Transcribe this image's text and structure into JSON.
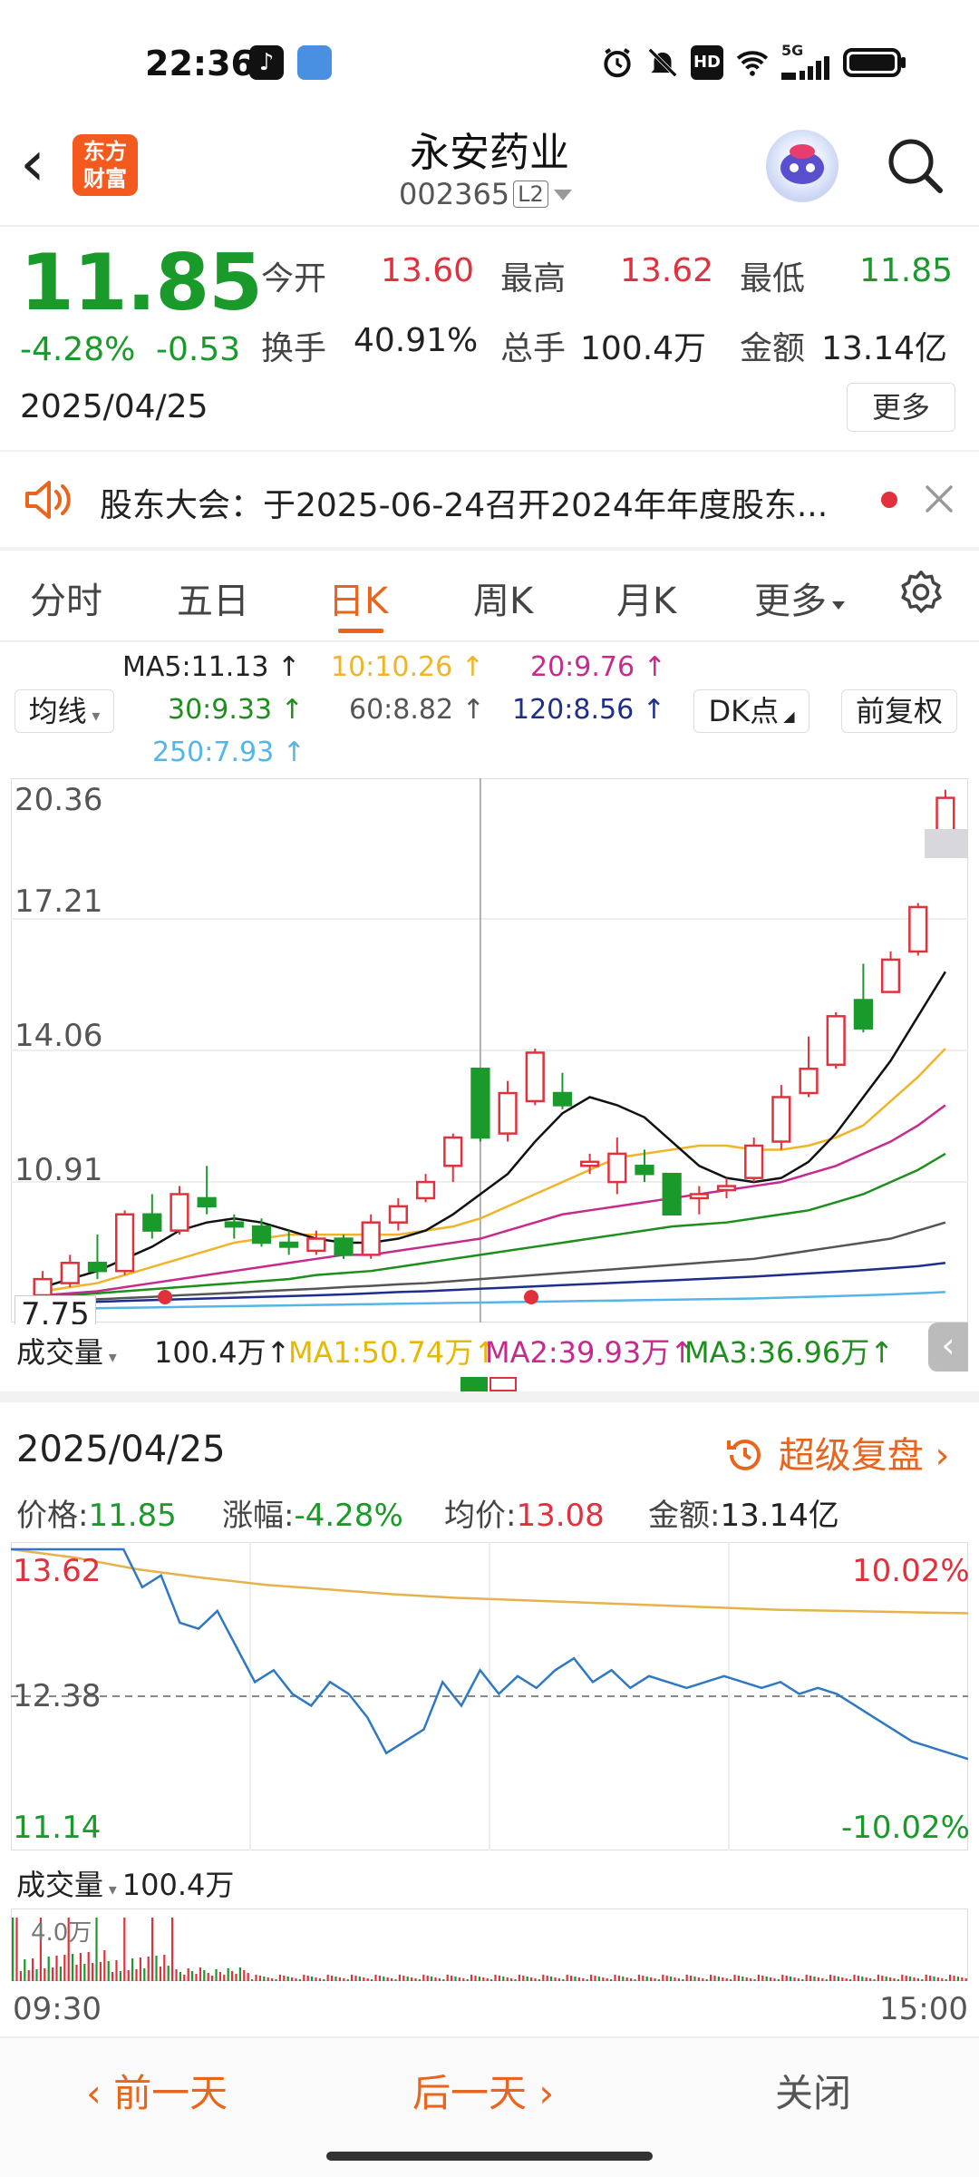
{
  "status": {
    "time": "22:36",
    "network": "5G"
  },
  "header": {
    "title": "永安药业",
    "code": "002365",
    "level": "L2",
    "logo": "东方财富"
  },
  "quote": {
    "price": "11.85",
    "change_pct": "-4.28%",
    "change": "-0.53",
    "date": "2025/04/25",
    "open_label": "今开",
    "open": "13.60",
    "high_label": "最高",
    "high": "13.62",
    "low_label": "最低",
    "low": "11.85",
    "turnover_label": "换手",
    "turnover": "40.91%",
    "volume_label": "总手",
    "volume": "100.4万",
    "amount_label": "金额",
    "amount": "13.14亿",
    "more_label": "更多"
  },
  "notice": {
    "text": "股东大会：于2025-06-24召开2024年年度股东..."
  },
  "tabs": [
    "分时",
    "五日",
    "日K",
    "周K",
    "月K",
    "更多"
  ],
  "active_tab": 2,
  "ma": {
    "button": "均线",
    "items": [
      {
        "label": "MA5:11.13",
        "color": "#222222"
      },
      {
        "label": "10:10.26",
        "color": "#f0b429"
      },
      {
        "label": "20:9.76",
        "color": "#c72a8d"
      },
      {
        "label": "30:9.33",
        "color": "#1c8f1c"
      },
      {
        "label": "60:8.82",
        "color": "#555555"
      },
      {
        "label": "120:8.56",
        "color": "#1f2d8c"
      },
      {
        "label": "250:7.93",
        "color": "#55b6e6"
      }
    ],
    "dk": "DK点",
    "fq": "前复权"
  },
  "kaxis": [
    "20.36",
    "17.21",
    "14.06",
    "10.91",
    "7.75"
  ],
  "volbar": {
    "label": "成交量",
    "value": "100.4万",
    "ma1": "MA1:50.74万",
    "ma2": "MA2:39.93万",
    "ma3": "MA3:36.96万"
  },
  "intraday": {
    "date": "2025/04/25",
    "fupan": "超级复盘",
    "price_label": "价格:",
    "price": "11.85",
    "pct_label": "涨幅:",
    "pct": "-4.28%",
    "avg_label": "均价:",
    "avg": "13.08",
    "amt_label": "金额:",
    "amt": "13.14亿",
    "top": "13.62",
    "mid": "12.38",
    "bottom": "11.14",
    "top_pct": "10.02%",
    "bottom_pct": "-10.02%",
    "vol_label": "成交量",
    "vol_value": "100.4万",
    "vol_max": "4.0万",
    "t_start": "09:30",
    "t_end": "15:00"
  },
  "footer": {
    "prev": "前一天",
    "next": "后一天",
    "close": "关闭"
  },
  "colors": {
    "up": "#e0313c",
    "down": "#1a9a2a",
    "accent": "#e9651d"
  },
  "chart_data": {
    "type": "candlestick",
    "title": "",
    "ylim": [
      7.75,
      20.36
    ],
    "candles": [
      {
        "o": 8.0,
        "c": 8.4,
        "h": 8.6,
        "l": 7.9
      },
      {
        "o": 8.3,
        "c": 8.8,
        "h": 9.0,
        "l": 8.2
      },
      {
        "o": 8.8,
        "c": 8.6,
        "h": 9.5,
        "l": 8.4
      },
      {
        "o": 8.6,
        "c": 10.0,
        "h": 10.1,
        "l": 8.5
      },
      {
        "o": 10.0,
        "c": 9.6,
        "h": 10.5,
        "l": 9.4
      },
      {
        "o": 9.6,
        "c": 10.5,
        "h": 10.7,
        "l": 9.5
      },
      {
        "o": 10.4,
        "c": 10.2,
        "h": 11.2,
        "l": 10.0
      },
      {
        "o": 9.8,
        "c": 9.7,
        "h": 10.0,
        "l": 9.4
      },
      {
        "o": 9.7,
        "c": 9.3,
        "h": 9.9,
        "l": 9.2
      },
      {
        "o": 9.3,
        "c": 9.2,
        "h": 9.6,
        "l": 9.0
      },
      {
        "o": 9.1,
        "c": 9.4,
        "h": 9.6,
        "l": 9.0
      },
      {
        "o": 9.4,
        "c": 9.0,
        "h": 9.5,
        "l": 8.9
      },
      {
        "o": 9.0,
        "c": 9.8,
        "h": 10.0,
        "l": 8.9
      },
      {
        "o": 9.8,
        "c": 10.2,
        "h": 10.4,
        "l": 9.6
      },
      {
        "o": 10.4,
        "c": 10.8,
        "h": 11.0,
        "l": 10.3
      },
      {
        "o": 11.2,
        "c": 11.9,
        "h": 12.0,
        "l": 10.8
      },
      {
        "o": 13.6,
        "c": 11.9,
        "h": 13.6,
        "l": 11.8
      },
      {
        "o": 12.0,
        "c": 13.0,
        "h": 13.3,
        "l": 11.8
      },
      {
        "o": 12.8,
        "c": 14.0,
        "h": 14.1,
        "l": 12.7
      },
      {
        "o": 13.0,
        "c": 12.7,
        "h": 13.5,
        "l": 12.6
      },
      {
        "o": 11.2,
        "c": 11.3,
        "h": 11.5,
        "l": 11.0
      },
      {
        "o": 10.8,
        "c": 11.5,
        "h": 11.9,
        "l": 10.5
      },
      {
        "o": 11.2,
        "c": 11.0,
        "h": 11.6,
        "l": 10.8
      },
      {
        "o": 11.0,
        "c": 10.0,
        "h": 11.0,
        "l": 10.0
      },
      {
        "o": 10.4,
        "c": 10.5,
        "h": 10.7,
        "l": 10.0
      },
      {
        "o": 10.6,
        "c": 10.7,
        "h": 10.9,
        "l": 10.4
      },
      {
        "o": 10.9,
        "c": 11.7,
        "h": 11.9,
        "l": 10.8
      },
      {
        "o": 11.8,
        "c": 12.9,
        "h": 13.2,
        "l": 11.6
      },
      {
        "o": 13.0,
        "c": 13.6,
        "h": 14.4,
        "l": 12.9
      },
      {
        "o": 13.7,
        "c": 14.9,
        "h": 15.0,
        "l": 13.6
      },
      {
        "o": 15.3,
        "c": 14.6,
        "h": 16.2,
        "l": 14.5
      },
      {
        "o": 15.5,
        "c": 16.3,
        "h": 16.5,
        "l": 15.5
      },
      {
        "o": 16.5,
        "c": 17.6,
        "h": 17.7,
        "l": 16.4
      },
      {
        "o": 19.3,
        "c": 20.3,
        "h": 20.5,
        "l": 19.0
      }
    ],
    "ma5": [
      8.2,
      8.4,
      8.6,
      8.9,
      9.2,
      9.6,
      9.8,
      9.9,
      9.8,
      9.6,
      9.4,
      9.3,
      9.3,
      9.4,
      9.6,
      10.0,
      10.5,
      11.0,
      11.8,
      12.5,
      12.9,
      12.7,
      12.4,
      11.8,
      11.2,
      10.9,
      10.8,
      10.9,
      11.3,
      12.0,
      12.9,
      13.8,
      14.9,
      16.0
    ],
    "ma10": [
      8.1,
      8.2,
      8.3,
      8.5,
      8.7,
      8.9,
      9.1,
      9.3,
      9.4,
      9.5,
      9.5,
      9.5,
      9.5,
      9.5,
      9.6,
      9.7,
      9.9,
      10.2,
      10.5,
      10.8,
      11.1,
      11.4,
      11.5,
      11.6,
      11.7,
      11.7,
      11.6,
      11.6,
      11.7,
      11.9,
      12.2,
      12.8,
      13.4,
      14.1
    ],
    "ma20": [
      8.0,
      8.05,
      8.1,
      8.2,
      8.3,
      8.4,
      8.5,
      8.6,
      8.7,
      8.8,
      8.9,
      9.0,
      9.0,
      9.1,
      9.2,
      9.3,
      9.4,
      9.6,
      9.8,
      10.0,
      10.1,
      10.2,
      10.3,
      10.4,
      10.5,
      10.6,
      10.7,
      10.8,
      11.0,
      11.2,
      11.5,
      11.8,
      12.2,
      12.7
    ],
    "ma30": [
      7.95,
      8.0,
      8.05,
      8.1,
      8.15,
      8.2,
      8.25,
      8.3,
      8.35,
      8.4,
      8.5,
      8.55,
      8.6,
      8.7,
      8.8,
      8.9,
      9.0,
      9.1,
      9.2,
      9.3,
      9.4,
      9.5,
      9.6,
      9.7,
      9.75,
      9.8,
      9.9,
      10.0,
      10.1,
      10.3,
      10.5,
      10.8,
      11.1,
      11.5
    ],
    "ma60": [
      7.85,
      7.88,
      7.9,
      7.93,
      7.96,
      8.0,
      8.03,
      8.06,
      8.1,
      8.13,
      8.16,
      8.2,
      8.23,
      8.27,
      8.3,
      8.35,
      8.4,
      8.45,
      8.5,
      8.55,
      8.6,
      8.65,
      8.7,
      8.75,
      8.8,
      8.85,
      8.9,
      9.0,
      9.1,
      9.2,
      9.3,
      9.4,
      9.6,
      9.8
    ],
    "ma120": [
      7.8,
      7.82,
      7.84,
      7.86,
      7.88,
      7.9,
      7.92,
      7.94,
      7.96,
      7.98,
      8.0,
      8.02,
      8.05,
      8.08,
      8.1,
      8.13,
      8.16,
      8.19,
      8.22,
      8.25,
      8.28,
      8.31,
      8.34,
      8.37,
      8.4,
      8.43,
      8.46,
      8.5,
      8.54,
      8.58,
      8.62,
      8.67,
      8.72,
      8.8
    ],
    "ma250": [
      7.66,
      7.67,
      7.68,
      7.69,
      7.7,
      7.71,
      7.72,
      7.73,
      7.74,
      7.75,
      7.76,
      7.77,
      7.78,
      7.79,
      7.8,
      7.81,
      7.82,
      7.83,
      7.84,
      7.85,
      7.86,
      7.87,
      7.88,
      7.89,
      7.9,
      7.91,
      7.92,
      7.94,
      7.96,
      7.98,
      8.0,
      8.02,
      8.05,
      8.08
    ],
    "intraday_price": [
      13.62,
      13.62,
      13.62,
      13.62,
      13.62,
      13.62,
      13.62,
      13.3,
      13.4,
      13.0,
      12.95,
      13.1,
      12.8,
      12.5,
      12.6,
      12.4,
      12.3,
      12.5,
      12.4,
      12.2,
      11.9,
      12.0,
      12.1,
      12.5,
      12.3,
      12.6,
      12.4,
      12.55,
      12.45,
      12.6,
      12.7,
      12.5,
      12.6,
      12.45,
      12.55,
      12.5,
      12.45,
      12.5,
      12.55,
      12.5,
      12.45,
      12.5,
      12.4,
      12.45,
      12.4,
      12.3,
      12.2,
      12.1,
      12.0,
      11.95,
      11.9,
      11.85
    ],
    "intraday_avg": [
      13.62,
      13.55,
      13.45,
      13.38,
      13.32,
      13.28,
      13.24,
      13.21,
      13.19,
      13.17,
      13.15,
      13.13,
      13.11,
      13.1,
      13.09,
      13.08
    ]
  }
}
